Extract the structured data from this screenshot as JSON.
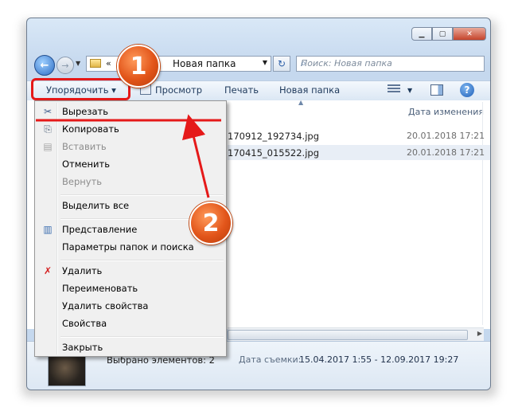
{
  "window": {
    "minimize_glyph": "▁",
    "maximize_glyph": "▢",
    "close_glyph": "✕"
  },
  "nav": {
    "back_glyph": "←",
    "forward_glyph": "→",
    "history_glyph": "▼",
    "address_chevron": "«",
    "address_path": "Новая папка",
    "address_dropdown": "▼",
    "refresh_glyph": "↻",
    "search_placeholder": "Поиск: Новая папка",
    "search_icon_glyph": "⌕"
  },
  "toolbar": {
    "organize": "Упорядочить ▾",
    "preview": "Просмотр",
    "print": "Печать",
    "new_folder": "Новая папка",
    "views_dropdown": "▼",
    "help_glyph": "?"
  },
  "list": {
    "sort_indicator": "▲",
    "column_date": "Дата изменения",
    "files": [
      {
        "name": "170912_192734.jpg",
        "date": "20.01.2018 17:21"
      },
      {
        "name": "170415_015522.jpg",
        "date": "20.01.2018 17:21"
      }
    ],
    "hscroll_arrow": "▶"
  },
  "details": {
    "count_text": "Выбрано элементов: 2",
    "date_label": "Дата съемки:",
    "date_value": "15.04.2017 1:55 - 12.09.2017 19:27"
  },
  "menu": {
    "items": [
      {
        "label": "Вырезать",
        "icon": "scissors-icon",
        "glyph": "✂",
        "enabled": true
      },
      {
        "label": "Копировать",
        "icon": "copy-icon",
        "glyph": "⎘",
        "enabled": true
      },
      {
        "label": "Вставить",
        "icon": "paste-icon",
        "glyph": "▤",
        "enabled": false
      },
      {
        "label": "Отменить",
        "enabled": true
      },
      {
        "label": "Вернуть",
        "enabled": false
      },
      {
        "label": "Выделить все",
        "enabled": true
      },
      {
        "label": "Представление",
        "icon": "layout-icon",
        "glyph": "▥",
        "enabled": true
      },
      {
        "label": "Параметры папок и поиска",
        "enabled": true
      },
      {
        "label": "Удалить",
        "icon": "delete-icon",
        "glyph": "✗",
        "enabled": true
      },
      {
        "label": "Переименовать",
        "enabled": true
      },
      {
        "label": "Удалить свойства",
        "enabled": true
      },
      {
        "label": "Свойства",
        "enabled": true
      },
      {
        "label": "Закрыть",
        "enabled": true
      }
    ]
  },
  "annotations": {
    "step1": "1",
    "step2": "2",
    "color": "#e51919"
  }
}
